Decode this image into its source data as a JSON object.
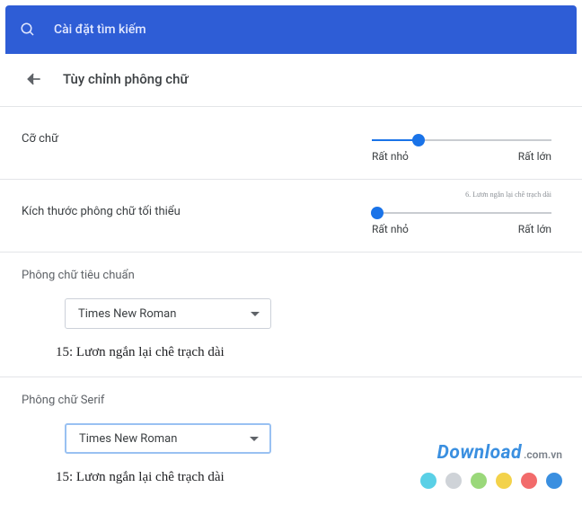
{
  "topbar": {
    "search_label": "Cài đặt tìm kiếm"
  },
  "header": {
    "title": "Tùy chỉnh phông chữ"
  },
  "sliders": {
    "font_size": {
      "label": "Cỡ chữ",
      "min_label": "Rất nhỏ",
      "max_label": "Rất lớn",
      "position_pct": 26
    },
    "min_font_size": {
      "label": "Kích thước phông chữ tối thiểu",
      "caption": "6. Lươn ngắn lại chê trạch dài",
      "min_label": "Rất nhỏ",
      "max_label": "Rất lớn",
      "position_pct": 3
    }
  },
  "sections": {
    "standard": {
      "heading": "Phông chữ tiêu chuẩn",
      "selected": "Times New Roman",
      "preview": "15: Lươn ngắn lại chê trạch dài"
    },
    "serif": {
      "heading": "Phông chữ Serif",
      "selected": "Times New Roman",
      "preview": "15: Lươn ngắn lại chê trạch dài"
    }
  },
  "watermark": {
    "brand": "Download",
    "domain": ".com.vn",
    "dot_colors": [
      "#5ad0e6",
      "#cfd3d8",
      "#9ad87a",
      "#f3d24a",
      "#f26b6b",
      "#3a8fe0"
    ]
  }
}
